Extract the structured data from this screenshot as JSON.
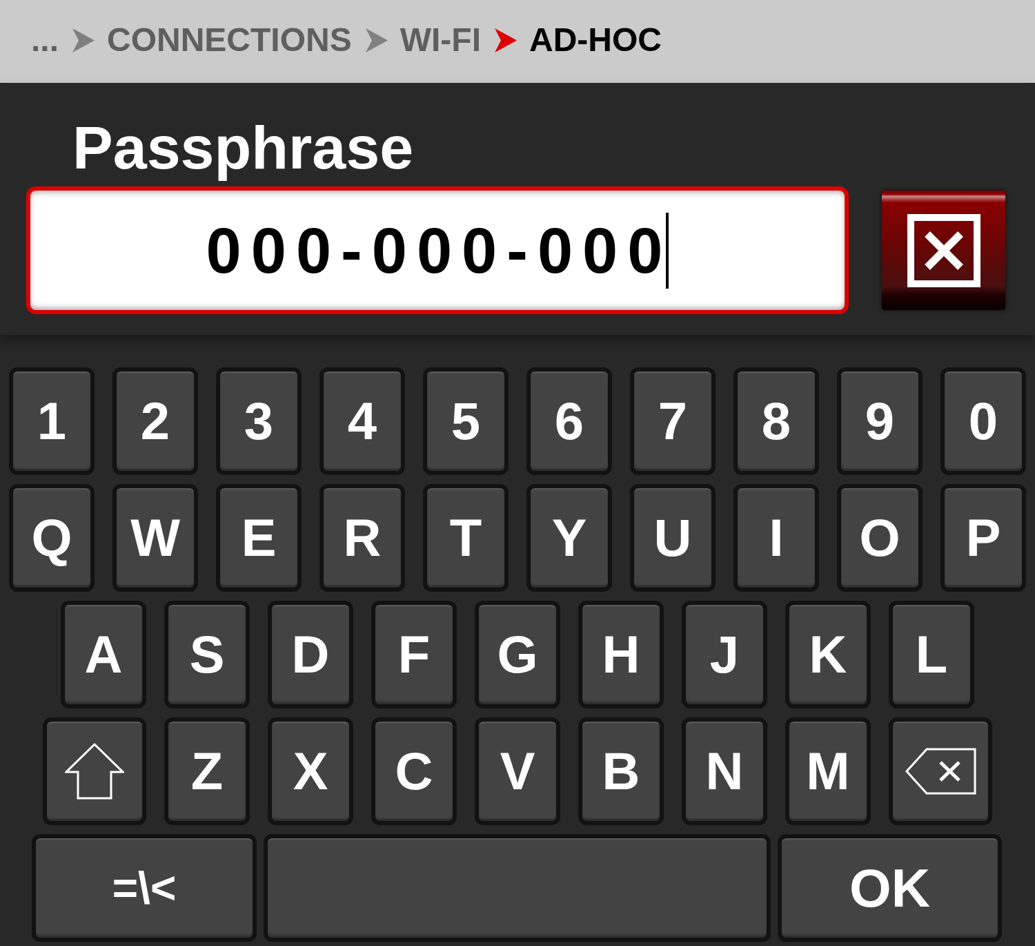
{
  "breadcrumb": [
    {
      "label": "...",
      "current": false
    },
    {
      "label": "CONNECTIONS",
      "current": false
    },
    {
      "label": "WI-FI",
      "current": false
    },
    {
      "label": "AD-HOC",
      "current": true
    }
  ],
  "passphrase": {
    "label": "Passphrase",
    "value": "000-000-000",
    "focused": true
  },
  "keyboard": {
    "rows": [
      {
        "keys": [
          {
            "kind": "char",
            "label": "1"
          },
          {
            "kind": "char",
            "label": "2"
          },
          {
            "kind": "char",
            "label": "3"
          },
          {
            "kind": "char",
            "label": "4"
          },
          {
            "kind": "char",
            "label": "5"
          },
          {
            "kind": "char",
            "label": "6"
          },
          {
            "kind": "char",
            "label": "7"
          },
          {
            "kind": "char",
            "label": "8"
          },
          {
            "kind": "char",
            "label": "9"
          },
          {
            "kind": "char",
            "label": "0"
          }
        ]
      },
      {
        "keys": [
          {
            "kind": "char",
            "label": "Q"
          },
          {
            "kind": "char",
            "label": "W"
          },
          {
            "kind": "char",
            "label": "E"
          },
          {
            "kind": "char",
            "label": "R"
          },
          {
            "kind": "char",
            "label": "T"
          },
          {
            "kind": "char",
            "label": "Y"
          },
          {
            "kind": "char",
            "label": "U"
          },
          {
            "kind": "char",
            "label": "I"
          },
          {
            "kind": "char",
            "label": "O"
          },
          {
            "kind": "char",
            "label": "P"
          }
        ]
      },
      {
        "keys": [
          {
            "kind": "char",
            "label": "A"
          },
          {
            "kind": "char",
            "label": "S"
          },
          {
            "kind": "char",
            "label": "D"
          },
          {
            "kind": "char",
            "label": "F"
          },
          {
            "kind": "char",
            "label": "G"
          },
          {
            "kind": "char",
            "label": "H"
          },
          {
            "kind": "char",
            "label": "J"
          },
          {
            "kind": "char",
            "label": "K"
          },
          {
            "kind": "char",
            "label": "L"
          }
        ]
      },
      {
        "keys": [
          {
            "kind": "shift"
          },
          {
            "kind": "char",
            "label": "Z"
          },
          {
            "kind": "char",
            "label": "X"
          },
          {
            "kind": "char",
            "label": "C"
          },
          {
            "kind": "char",
            "label": "V"
          },
          {
            "kind": "char",
            "label": "B"
          },
          {
            "kind": "char",
            "label": "N"
          },
          {
            "kind": "char",
            "label": "M"
          },
          {
            "kind": "backspace"
          }
        ]
      },
      {
        "keys": [
          {
            "kind": "symbols",
            "label": "=\\<"
          },
          {
            "kind": "space"
          },
          {
            "kind": "ok",
            "label": "OK"
          }
        ]
      }
    ]
  }
}
